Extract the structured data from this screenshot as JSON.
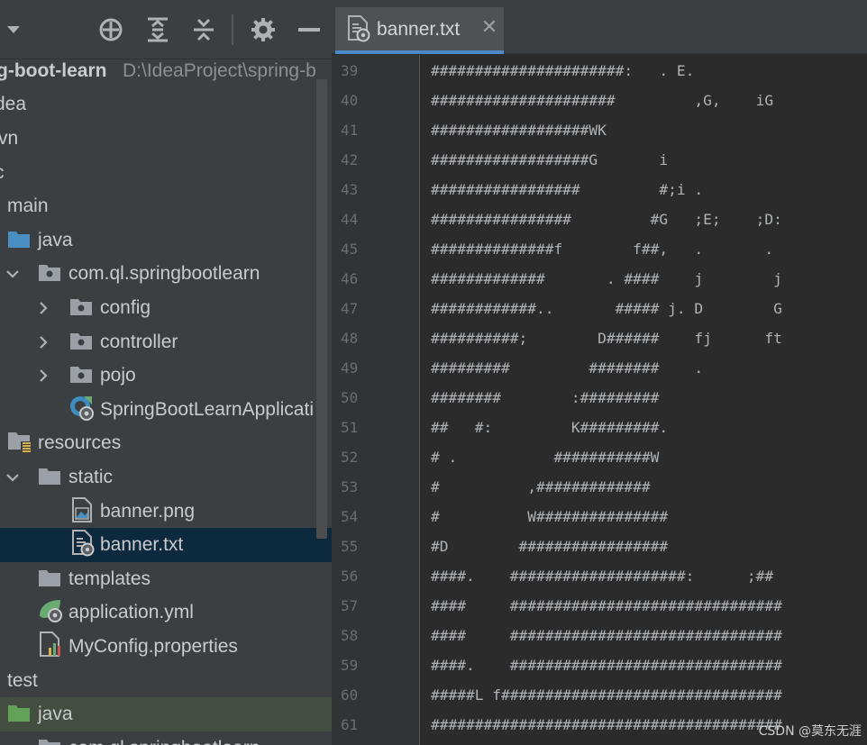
{
  "project": {
    "toolbar_icons": [
      "locate-icon",
      "expand-all-icon",
      "collapse-all-icon",
      "gear-icon",
      "hide-icon"
    ],
    "root_name": "g-boot-learn",
    "root_path": "D:\\IdeaProject\\spring-b",
    "items": [
      {
        "label": "dea"
      },
      {
        "label": "vn"
      },
      {
        "label": "c"
      },
      {
        "label": "main"
      },
      {
        "label": "java"
      },
      {
        "label": "com.ql.springbootlearn"
      },
      {
        "label": "config"
      },
      {
        "label": "controller"
      },
      {
        "label": "pojo"
      },
      {
        "label": "SpringBootLearnApplicati"
      },
      {
        "label": "resources"
      },
      {
        "label": "static"
      },
      {
        "label": "banner.png"
      },
      {
        "label": "banner.txt"
      },
      {
        "label": "templates"
      },
      {
        "label": "application.yml"
      },
      {
        "label": "MyConfig.properties"
      },
      {
        "label": "test"
      },
      {
        "label": "java"
      },
      {
        "label": "com.ql.springbootlearn"
      }
    ]
  },
  "editor": {
    "tab_title": "banner.txt",
    "close_glyph": "✕",
    "lines": [
      {
        "n": "39",
        "text": "######################:   . E."
      },
      {
        "n": "40",
        "text": "#####################         ,G,    iG"
      },
      {
        "n": "41",
        "text": "##################WK"
      },
      {
        "n": "42",
        "text": "##################G       i"
      },
      {
        "n": "43",
        "text": "#################         #;i ."
      },
      {
        "n": "44",
        "text": "################         #G   ;E;    ;D:"
      },
      {
        "n": "45",
        "text": "##############f        f##,   .       ."
      },
      {
        "n": "46",
        "text": "#############       . ####    j        j"
      },
      {
        "n": "47",
        "text": "############..       ##### j. D        G"
      },
      {
        "n": "48",
        "text": "##########;        D######    fj      ft"
      },
      {
        "n": "49",
        "text": "#########         ########    ."
      },
      {
        "n": "50",
        "text": "########        :#########"
      },
      {
        "n": "51",
        "text": "##   #:         K#########."
      },
      {
        "n": "52",
        "text": "# .           ###########W"
      },
      {
        "n": "53",
        "text": "#          ,#############"
      },
      {
        "n": "54",
        "text": "#          W###############"
      },
      {
        "n": "55",
        "text": "#D        #################"
      },
      {
        "n": "56",
        "text": "####.    ####################:      ;##"
      },
      {
        "n": "57",
        "text": "####     ###############################"
      },
      {
        "n": "58",
        "text": "####     ###############################"
      },
      {
        "n": "59",
        "text": "####.    ###############################"
      },
      {
        "n": "60",
        "text": "#####L f################################"
      },
      {
        "n": "61",
        "text": "########################################"
      }
    ]
  },
  "watermark": "CSDN @莫东无涯"
}
